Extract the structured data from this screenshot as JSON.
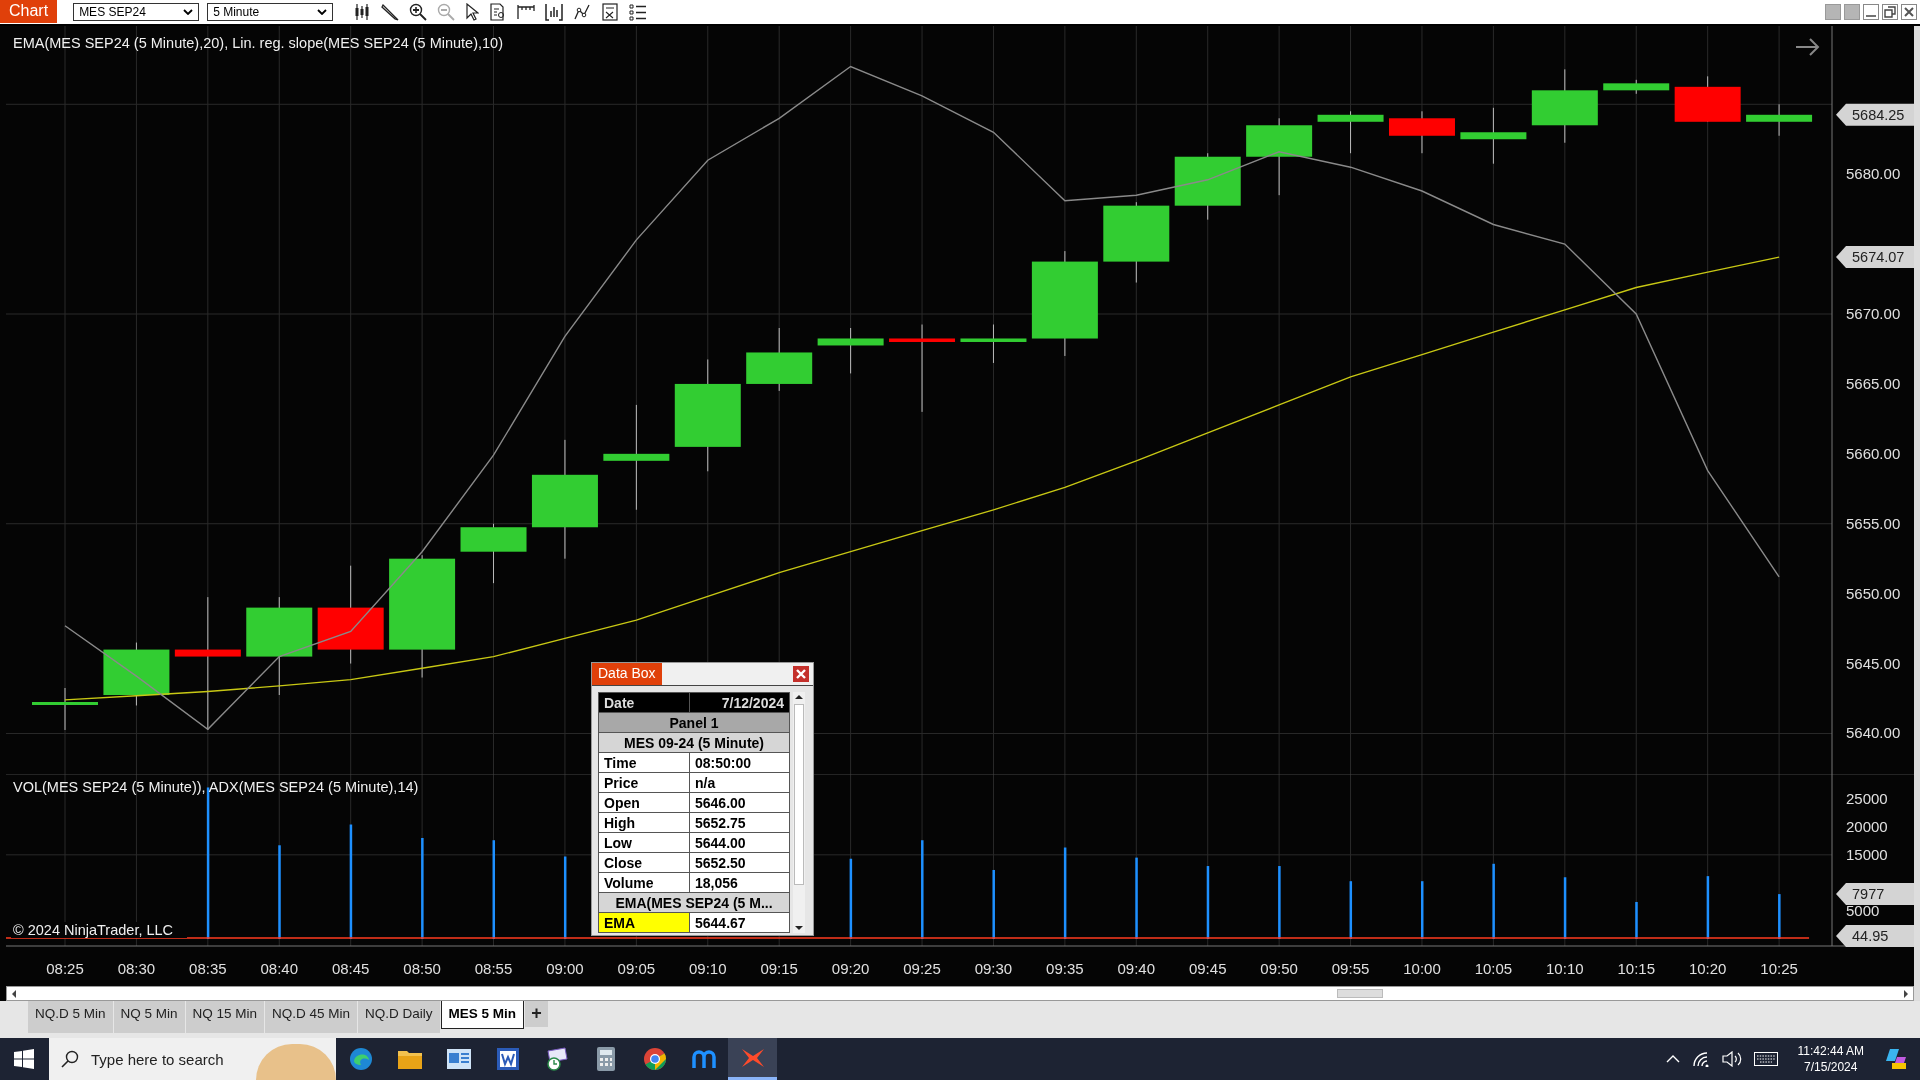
{
  "toolbar": {
    "title": "Chart",
    "instrument": "MES SEP24",
    "interval": "5 Minute",
    "tools": [
      {
        "kind": "candles",
        "disabled": false
      },
      {
        "kind": "pencil",
        "disabled": false
      },
      {
        "kind": "zoom-in",
        "disabled": false
      },
      {
        "kind": "zoom-out",
        "disabled": true
      },
      {
        "kind": "pointer",
        "disabled": false
      },
      {
        "kind": "data-box",
        "disabled": false
      },
      {
        "kind": "ruler",
        "disabled": false
      },
      {
        "kind": "bars",
        "disabled": false
      },
      {
        "kind": "line",
        "disabled": false
      },
      {
        "kind": "properties",
        "disabled": false
      },
      {
        "kind": "list",
        "disabled": false
      }
    ]
  },
  "price_panel": {
    "title": "EMA(MES SEP24 (5 Minute),20), Lin. reg. slope(MES SEP24 (5 Minute),10)",
    "price_marker": "5684.25",
    "ema_marker": "5674.07",
    "chart_data": {
      "type": "line",
      "grid": true,
      "series": [
        {
          "color": "#c8c814",
          "values": [
            5642.4,
            5642.7,
            5643.0,
            5643.4,
            5643.85,
            5644.67,
            5645.5,
            5646.8,
            5648.1,
            5649.8,
            5651.5,
            5653.0,
            5654.5,
            5656.0,
            5657.6,
            5659.5,
            5661.5,
            5663.5,
            5665.5,
            5667.1,
            5668.7,
            5670.3,
            5671.9,
            5673.0,
            5674.07
          ]
        },
        {
          "color": "#8a8a8a",
          "values": [
            5647.7,
            5644.1,
            5640.3,
            5645.5,
            5647.3,
            5653.0,
            5659.9,
            5668.4,
            5675.3,
            5681.0,
            5684.0,
            5687.7,
            5685.6,
            5683.0,
            5678.1,
            5678.5,
            5679.6,
            5681.6,
            5680.5,
            5678.8,
            5676.4,
            5675.0,
            5670.0,
            5658.8,
            5651.2
          ]
        }
      ],
      "ylim": [
        5637.1,
        5690.6
      ],
      "yticks": [
        {
          "value": 5640,
          "label": "5640.00"
        },
        {
          "value": 5645,
          "label": "5645.00"
        },
        {
          "value": 5650,
          "label": "5650.00"
        },
        {
          "value": 5655,
          "label": "5655.00"
        },
        {
          "value": 5660,
          "label": "5660.00"
        },
        {
          "value": 5665,
          "label": "5665.00"
        },
        {
          "value": 5670,
          "label": "5670.00"
        },
        {
          "value": 5680,
          "label": "5680.00"
        }
      ]
    }
  },
  "volume_panel": {
    "title": "VOL(MES SEP24 (5 Minute)), ADX(MES SEP24 (5 Minute),14)",
    "volume_marker": "7977",
    "adx_marker": "44.95",
    "copyright": "© 2024 NinjaTrader, LLC",
    "chart_data": {
      "type": "bar",
      "grid": true,
      "categories": [
        "08:25",
        "08:30",
        "08:35",
        "08:40",
        "08:45",
        "08:50",
        "08:55",
        "09:00",
        "09:05",
        "09:10",
        "09:15",
        "09:20",
        "09:25",
        "09:30",
        "09:35",
        "09:40",
        "09:45",
        "09:50",
        "09:55",
        "10:00",
        "10:05",
        "10:10",
        "10:15",
        "10:20",
        "10:25"
      ],
      "series": [
        {
          "color": "#1e90ff",
          "values": [
            null,
            null,
            27000,
            16700,
            20400,
            18000,
            17600,
            14700,
            null,
            null,
            null,
            14300,
            17600,
            12300,
            16300,
            14500,
            13000,
            13000,
            10300,
            10300,
            13400,
            11000,
            6600,
            11200,
            8000
          ]
        }
      ],
      "ylim": [
        0,
        29400
      ],
      "yticks": [
        {
          "value": 5000,
          "label": "5000"
        },
        {
          "value": 15000,
          "label": "15000"
        },
        {
          "value": 20000,
          "label": "20000"
        },
        {
          "value": 25000,
          "label": "25000"
        }
      ]
    }
  },
  "data_box": {
    "title": "Data Box",
    "rows": [
      {
        "kind": "head",
        "label": "Date",
        "value": "7/12/2024"
      },
      {
        "kind": "section",
        "label": "Panel 1"
      },
      {
        "kind": "subsection",
        "label": "MES 09-24 (5 Minute)"
      },
      {
        "kind": "row",
        "label": "Time",
        "value": "08:50:00"
      },
      {
        "kind": "row",
        "label": "Price",
        "value": "n/a"
      },
      {
        "kind": "row",
        "label": "Open",
        "value": "5646.00"
      },
      {
        "kind": "row",
        "label": "High",
        "value": "5652.75"
      },
      {
        "kind": "row",
        "label": "Low",
        "value": "5644.00"
      },
      {
        "kind": "row",
        "label": "Close",
        "value": "5652.50"
      },
      {
        "kind": "row",
        "label": "Volume",
        "value": "18,056"
      },
      {
        "kind": "subsection",
        "label": "EMA(MES SEP24 (5 M..."
      },
      {
        "kind": "plot",
        "label": "EMA",
        "value": "5644.67",
        "color": "#ffff00"
      }
    ]
  },
  "tabs": [
    {
      "label": "NQ.D 5 Min",
      "selected": false
    },
    {
      "label": "NQ 5 Min",
      "selected": false
    },
    {
      "label": "NQ 15 Min",
      "selected": false
    },
    {
      "label": "NQ.D 45 Min",
      "selected": false
    },
    {
      "label": "NQ.D  Daily",
      "selected": false
    },
    {
      "label": "MES 5 Min",
      "selected": true
    }
  ],
  "add_tab": "+",
  "taskbar": {
    "search_placeholder": "Type here to search",
    "apps": [
      {
        "kind": "edge",
        "selected": false
      },
      {
        "kind": "folder",
        "selected": false
      },
      {
        "kind": "app",
        "selected": false
      },
      {
        "kind": "word",
        "selected": false
      },
      {
        "kind": "mail",
        "selected": false
      },
      {
        "kind": "calculator",
        "selected": false
      },
      {
        "kind": "chrome",
        "selected": false
      },
      {
        "kind": "m",
        "selected": false
      },
      {
        "kind": "ninja",
        "selected": true
      }
    ],
    "time": "11:42:44 AM",
    "date": "7/15/2024"
  }
}
